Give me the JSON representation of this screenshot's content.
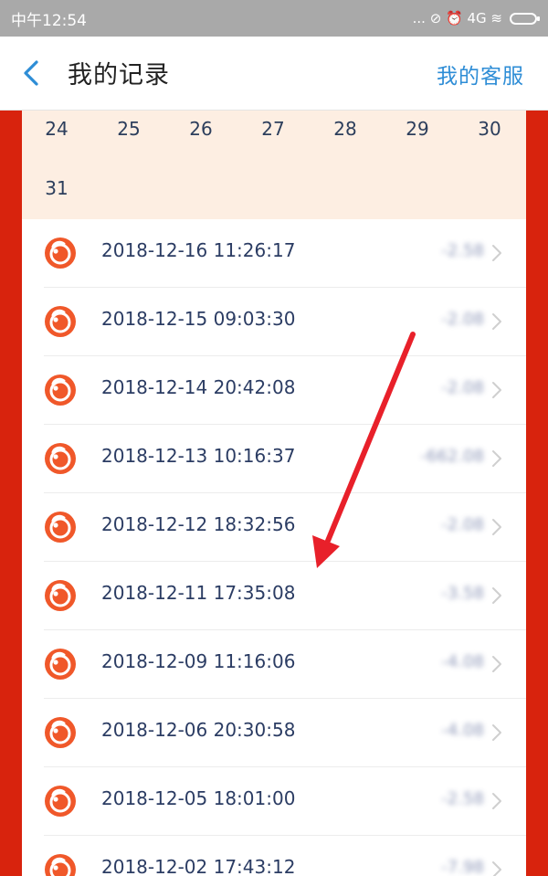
{
  "status_bar": {
    "time": "中午12:54",
    "indicators": "... ⊘ ⏰ 4G ≋"
  },
  "header": {
    "back_icon": "chevron-left-icon",
    "title": "我的记录",
    "service_link": "我的客服"
  },
  "calendar": {
    "row1": [
      "24",
      "25",
      "26",
      "27",
      "28",
      "29",
      "30"
    ],
    "row2": [
      "31"
    ]
  },
  "records": [
    {
      "time": "2018-12-16 11:26:17",
      "amount": "-2.58"
    },
    {
      "time": "2018-12-15 09:03:30",
      "amount": "-2.08"
    },
    {
      "time": "2018-12-14 20:42:08",
      "amount": "-2.08"
    },
    {
      "time": "2018-12-13 10:16:37",
      "amount": "-662.08"
    },
    {
      "time": "2018-12-12 18:32:56",
      "amount": "-2.08"
    },
    {
      "time": "2018-12-11 17:35:08",
      "amount": "-3.58"
    },
    {
      "time": "2018-12-09 11:16:06",
      "amount": "-4.08"
    },
    {
      "time": "2018-12-06 20:30:58",
      "amount": "-4.08"
    },
    {
      "time": "2018-12-05 18:01:00",
      "amount": "-2.58"
    },
    {
      "time": "2018-12-02 17:43:12",
      "amount": "-7.98"
    }
  ],
  "colors": {
    "accent": "#2e8dd6",
    "frame": "#d8230d",
    "calendar_bg": "#fdeee2",
    "record_icon": "#f0582a",
    "arrow": "#e8202a"
  }
}
